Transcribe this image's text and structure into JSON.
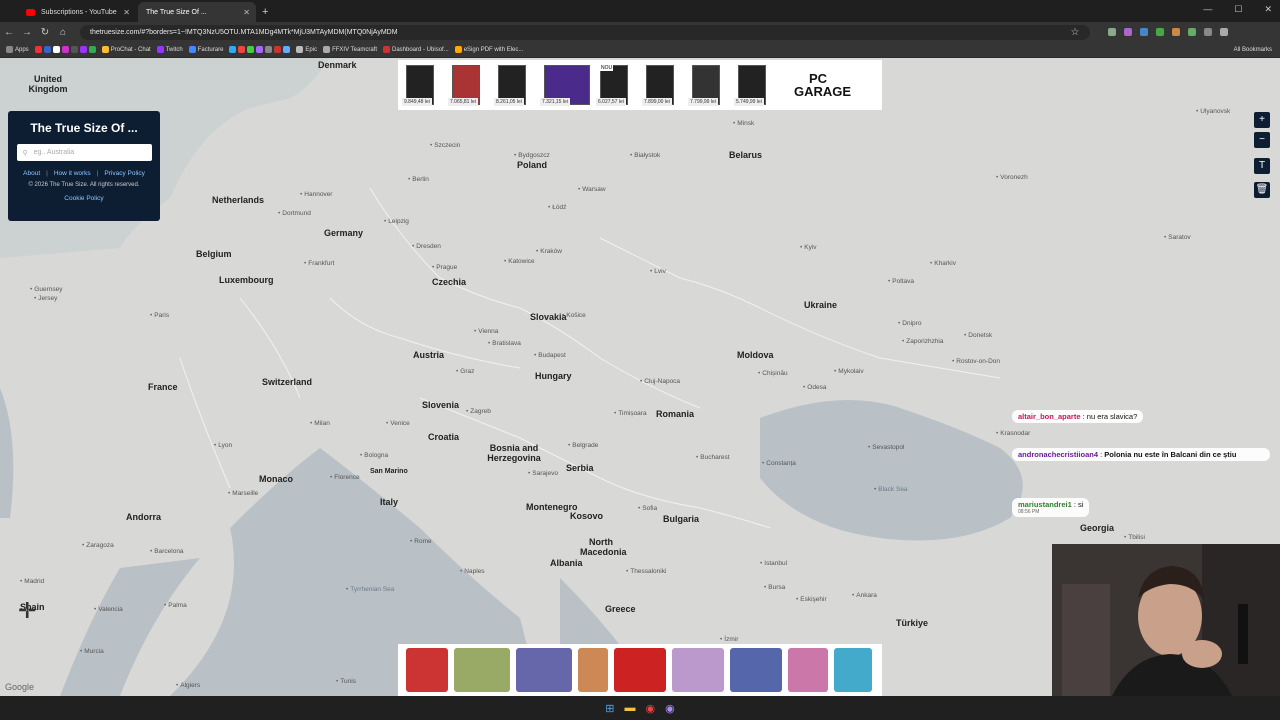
{
  "browser": {
    "tabs": [
      {
        "label": "Subscriptions - YouTube",
        "active": false
      },
      {
        "label": "The True Size Of ...",
        "active": true
      }
    ],
    "url": "thetruesize.com/#?borders=1~!MTQ3NzU5OTU.MTA1MDg4MTk*MjU3MTAyMDM(MTQ0NjAyMDM",
    "bookmarks": [
      "Apps",
      "ProChat - Chat",
      "Twitch",
      "Facturare",
      "Epic",
      "FFXIV Teamcraft",
      "Dashboard - Ubisof...",
      "eSign PDF with Elec..."
    ],
    "all_bookmarks_label": "All Bookmarks"
  },
  "panel": {
    "title": "The True Size Of ...",
    "search_placeholder": "eg.. Australia",
    "links": [
      "About",
      "How it works",
      "Privacy Policy"
    ],
    "copyright": "© 2026 The True Size. All rights reserved.",
    "cookie": "Cookie Policy"
  },
  "map": {
    "countries": [
      {
        "name": "Denmark"
      },
      {
        "name": "United Kingdom"
      },
      {
        "name": "Netherlands"
      },
      {
        "name": "Germany"
      },
      {
        "name": "Belgium"
      },
      {
        "name": "Luxembourg"
      },
      {
        "name": "France"
      },
      {
        "name": "Switzerland"
      },
      {
        "name": "Czechia"
      },
      {
        "name": "Austria"
      },
      {
        "name": "Slovakia"
      },
      {
        "name": "Hungary"
      },
      {
        "name": "Poland"
      },
      {
        "name": "Belarus"
      },
      {
        "name": "Ukraine"
      },
      {
        "name": "Moldova"
      },
      {
        "name": "Romania"
      },
      {
        "name": "Slovenia"
      },
      {
        "name": "Croatia"
      },
      {
        "name": "Bosnia and Herzegovina"
      },
      {
        "name": "Serbia"
      },
      {
        "name": "Montenegro"
      },
      {
        "name": "Kosovo"
      },
      {
        "name": "Bulgaria"
      },
      {
        "name": "North Macedonia"
      },
      {
        "name": "Albania"
      },
      {
        "name": "Greece"
      },
      {
        "name": "Italy"
      },
      {
        "name": "Monaco"
      },
      {
        "name": "San Marino"
      },
      {
        "name": "Andorra"
      },
      {
        "name": "Türkiye"
      },
      {
        "name": "Georgia"
      },
      {
        "name": "Spain"
      }
    ],
    "cities": [
      {
        "name": "Szczecin"
      },
      {
        "name": "Bydgoszcz"
      },
      {
        "name": "Białystok"
      },
      {
        "name": "Minsk"
      },
      {
        "name": "Berlin"
      },
      {
        "name": "Warsaw"
      },
      {
        "name": "Łódź"
      },
      {
        "name": "Leipzig"
      },
      {
        "name": "Dresden"
      },
      {
        "name": "Prague"
      },
      {
        "name": "Katowice"
      },
      {
        "name": "Kraków"
      },
      {
        "name": "Lviv"
      },
      {
        "name": "Kyiv"
      },
      {
        "name": "Kharkiv"
      },
      {
        "name": "Voronezh"
      },
      {
        "name": "Poltava"
      },
      {
        "name": "Vienna"
      },
      {
        "name": "Bratislava"
      },
      {
        "name": "Budapest"
      },
      {
        "name": "Košice"
      },
      {
        "name": "Dnipro"
      },
      {
        "name": "Zaporizhzhia"
      },
      {
        "name": "Donetsk"
      },
      {
        "name": "Chișinău"
      },
      {
        "name": "Odesa"
      },
      {
        "name": "Mykolaiv"
      },
      {
        "name": "Rostov-on-Don"
      },
      {
        "name": "Cluj-Napoca"
      },
      {
        "name": "Timișoara"
      },
      {
        "name": "Zagreb"
      },
      {
        "name": "Graz"
      },
      {
        "name": "Milan"
      },
      {
        "name": "Venice"
      },
      {
        "name": "Bologna"
      },
      {
        "name": "Florence"
      },
      {
        "name": "Bucharest"
      },
      {
        "name": "Belgrade"
      },
      {
        "name": "Sarajevo"
      },
      {
        "name": "Sofia"
      },
      {
        "name": "Constanța"
      },
      {
        "name": "Sevastopol"
      },
      {
        "name": "Krasnodar"
      },
      {
        "name": "Marseille"
      },
      {
        "name": "Barcelona"
      },
      {
        "name": "Madrid"
      },
      {
        "name": "Valencia"
      },
      {
        "name": "Palma"
      },
      {
        "name": "Zaragoza"
      },
      {
        "name": "Rome"
      },
      {
        "name": "Naples"
      },
      {
        "name": "Istanbul"
      },
      {
        "name": "Thessaloniki"
      },
      {
        "name": "Bursa"
      },
      {
        "name": "Eskişehir"
      },
      {
        "name": "Ankara"
      },
      {
        "name": "İzmir"
      },
      {
        "name": "Tunis"
      },
      {
        "name": "Algiers"
      },
      {
        "name": "Murcia"
      },
      {
        "name": "Frankfurt"
      },
      {
        "name": "Dortmund"
      },
      {
        "name": "Hannover"
      },
      {
        "name": "Lyon"
      },
      {
        "name": "Paris"
      },
      {
        "name": "Tbilisi"
      },
      {
        "name": "Saratov"
      },
      {
        "name": "Ulyanovsk"
      },
      {
        "name": "Jersey"
      },
      {
        "name": "Guernsey"
      }
    ],
    "google": "Google",
    "water_labels": [
      "Black Sea",
      "Tyrrhenian Sea"
    ]
  },
  "ads": {
    "top_brand": "PC GARAGE",
    "top_prices": [
      "9.849,48 lei",
      "7.065,81 lei",
      "8.261,05 lei",
      "7.321,15 lei",
      "6.027,57 lei",
      "7.899,00 lei",
      "7.799,99 lei",
      "5.749,99 lei"
    ],
    "top_badge": "NOU"
  },
  "chat": [
    {
      "user": "altair_bon_aparte",
      "message": "nu era slavica?",
      "time": ""
    },
    {
      "user": "andronachecristiioan4",
      "message": "Polonia nu este în Balcani din ce știu",
      "time": ""
    },
    {
      "user": "mariustandrei1",
      "message": "si",
      "time": "08:56 PM"
    }
  ],
  "colors": {
    "panel_bg": "#0d1e33",
    "map_land": "#d8d9d6",
    "map_sea": "#b9c1c7",
    "link": "#8ec4ff"
  }
}
